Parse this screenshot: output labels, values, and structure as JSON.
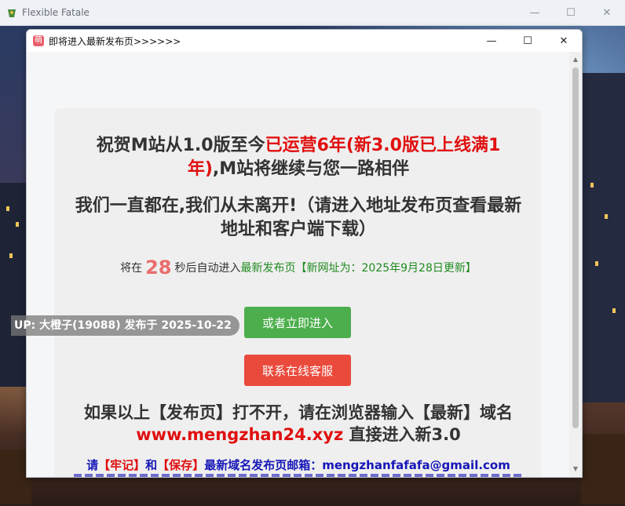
{
  "app_window": {
    "title": "Flexible Fatale",
    "controls": {
      "minimize_icon": "minimize-icon",
      "maximize_icon": "maximize-icon",
      "close_icon": "close-icon"
    }
  },
  "dialog": {
    "title": "即将进入最新发布页>>>>>>",
    "icon_glyph": "萌",
    "heading1": {
      "part1": "祝贺M站从1.0版至今",
      "part2_red": "已运营6年(新3.0版已上线满1年)",
      "part3": ",M站将继续与您一路相伴"
    },
    "heading2": "我们一直都在,我们从未离开!（请进入地址发布页查看最新地址和客户端下载）",
    "countdown": {
      "prefix": "将在",
      "seconds": "28",
      "suffix": "秒后自动进入",
      "link_text": "最新发布页",
      "update_note": "【新网址为：2025年9月28日更新】"
    },
    "buttons": {
      "enter_now": "或者立即进入",
      "contact_service": "联系在线客服"
    },
    "fallback": {
      "part1": "如果以上【发布页】打不开，请在浏览器输入【最新】域名 ",
      "domain": "www.mengzhan24.xyz",
      "part2": " 直接进入新3.0"
    },
    "mail_line": {
      "p1": "请",
      "r1": "【牢记】",
      "p2": "和",
      "r2": "【保存】",
      "p3": "最新域名发布页邮箱：mengzhanfafafa@gmail.com"
    }
  },
  "overlay_badge": "UP: 大橙子(19088) 发布于 2025-10-22",
  "colors": {
    "accent_red": "#e01010",
    "button_green": "#4cae4c",
    "button_red": "#ea4a3c",
    "link_green": "#1f8b1f",
    "mail_blue": "#1616b8"
  }
}
